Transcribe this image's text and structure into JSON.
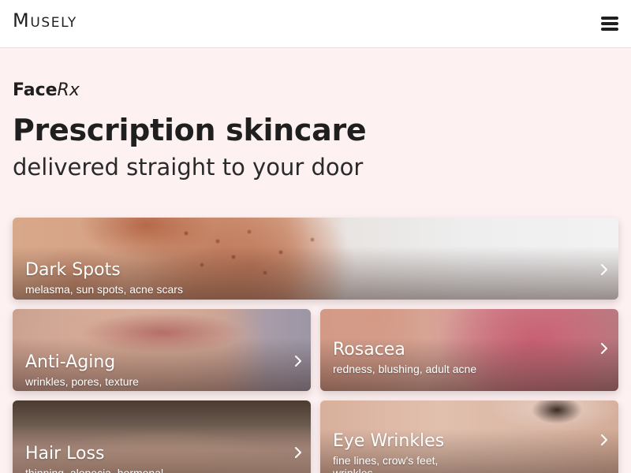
{
  "header": {
    "logo_first": "M",
    "logo_rest": "USELY",
    "menu_icon": "hamburger-menu-icon"
  },
  "hero": {
    "eyebrow_bold": "Face",
    "eyebrow_italic": "Rx",
    "headline": "Prescription skincare",
    "subhead": "delivered straight to your door"
  },
  "cards": [
    {
      "title": "Dark Spots",
      "description": "melasma, sun spots, acne scars",
      "icon": "chevron-right-icon"
    },
    {
      "title": "Anti-Aging",
      "description": "wrinkles, pores, texture",
      "icon": "chevron-right-icon"
    },
    {
      "title": "Rosacea",
      "description": "redness, blushing, adult acne",
      "icon": "chevron-right-icon"
    },
    {
      "title": "Hair Loss",
      "description": "thinning, alopecia, hormonal",
      "icon": "chevron-right-icon"
    },
    {
      "title": "Eye Wrinkles",
      "description": "fine lines, crow's feet, wrinkles",
      "icon": "chevron-right-icon"
    }
  ],
  "colors": {
    "page_background": "#fdf1f2",
    "header_background": "#ffffff",
    "text": "#1f1f1f"
  }
}
